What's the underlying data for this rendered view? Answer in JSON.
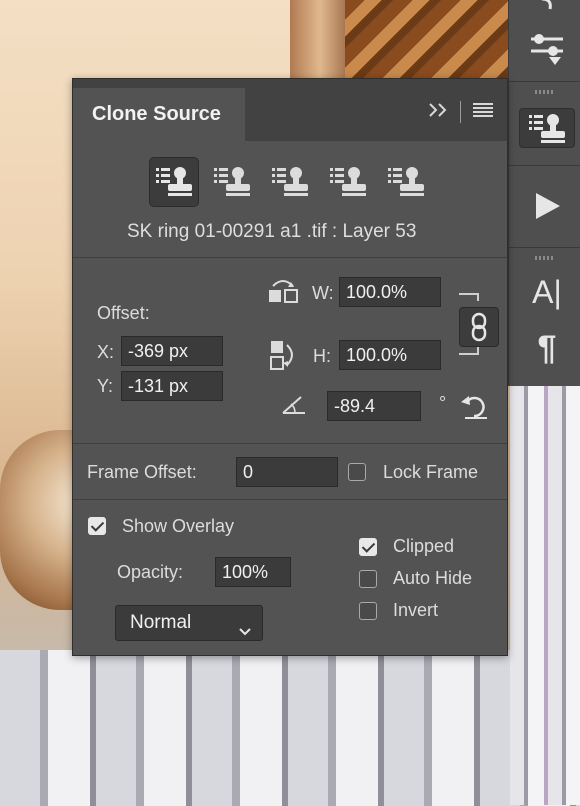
{
  "panel": {
    "title": "Clone Source",
    "source_file": "SK ring 01-00291 a1 .tif : Layer 53"
  },
  "offset": {
    "label": "Offset:",
    "x_label": "X:",
    "x_value": "-369 px",
    "y_label": "Y:",
    "y_value": "-131 px",
    "w_label": "W:",
    "w_value": "100.0%",
    "h_label": "H:",
    "h_value": "100.0%",
    "angle_value": "-89.4",
    "degree_symbol": "°"
  },
  "frame": {
    "offset_label": "Frame Offset:",
    "offset_value": "0",
    "lock_label": "Lock Frame",
    "lock_checked": false
  },
  "overlay": {
    "show_label": "Show Overlay",
    "show_checked": true,
    "opacity_label": "Opacity:",
    "opacity_value": "100%",
    "blend_mode": "Normal",
    "clipped_label": "Clipped",
    "clipped_checked": true,
    "auto_hide_label": "Auto Hide",
    "auto_hide_checked": false,
    "invert_label": "Invert",
    "invert_checked": false
  },
  "toolbar": {
    "type_label": "A|",
    "paragraph_label": "¶"
  }
}
